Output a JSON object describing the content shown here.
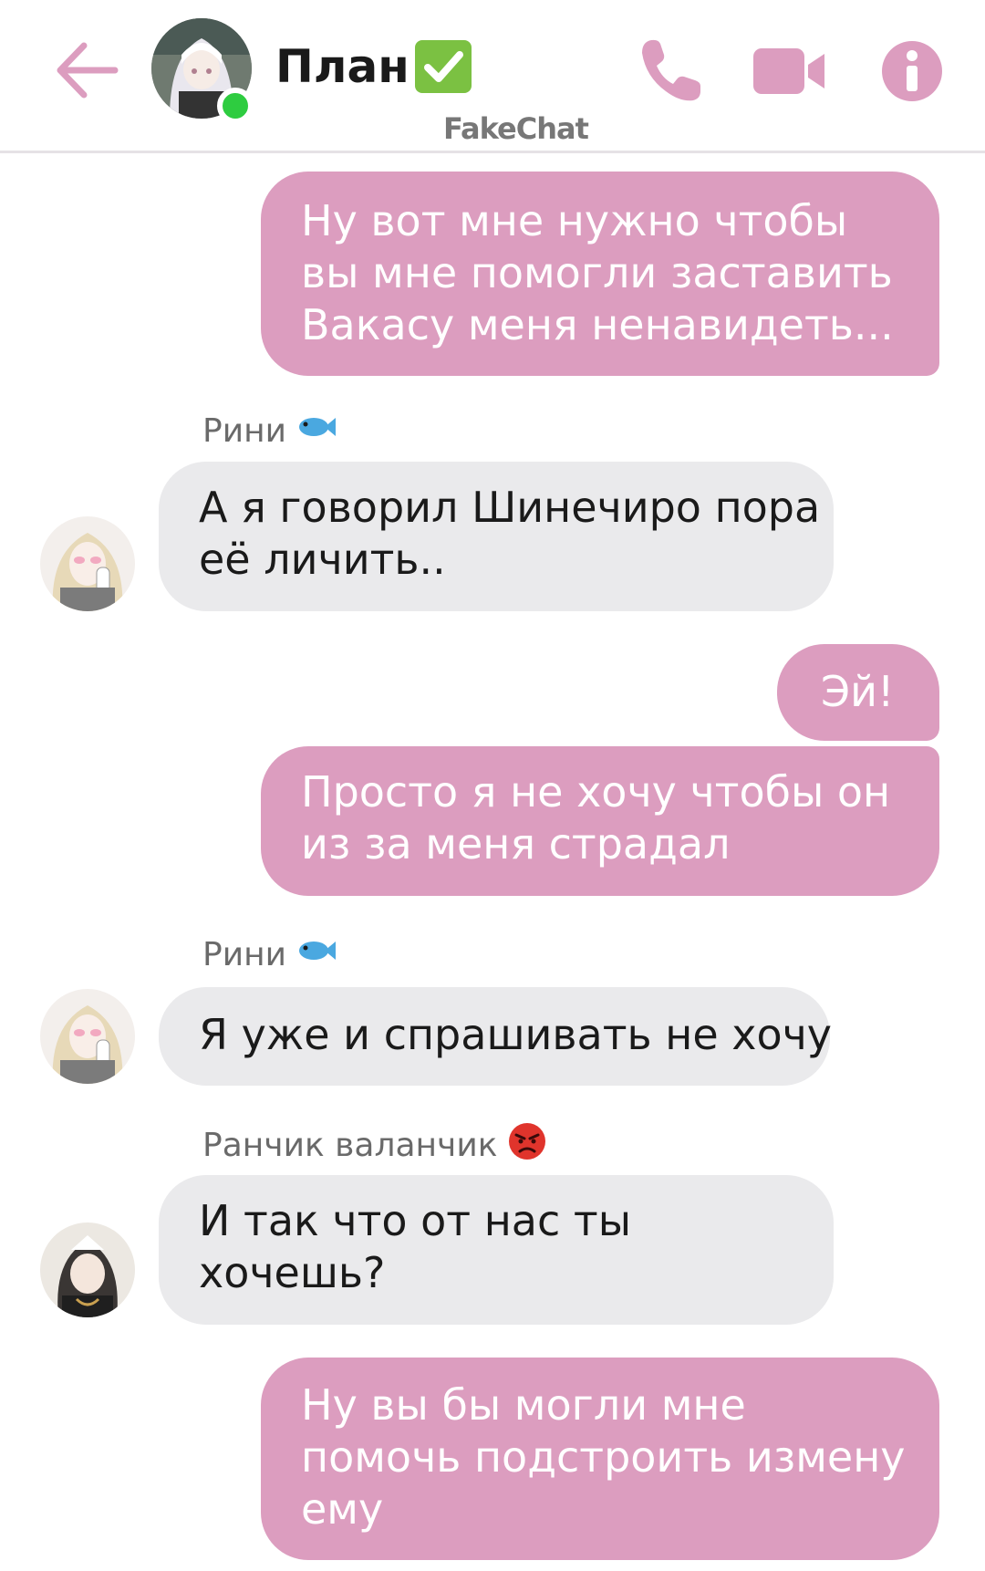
{
  "header": {
    "title": "План",
    "watermark": "FakeChat",
    "online": true,
    "icons": [
      "back-arrow-icon",
      "phone-icon",
      "video-camera-icon",
      "info-icon",
      "verified-check-icon"
    ]
  },
  "colors": {
    "accent": "#dc9dbf",
    "outgoing_bubble": "#dc9dbf",
    "incoming_bubble": "#eaeaec",
    "online": "#2ecc40"
  },
  "messages": [
    {
      "direction": "out",
      "text_lines": [
        "Ну вот мне нужно чтобы",
        "вы мне помогли заставить",
        "Вакасу меня ненавидеть..."
      ]
    },
    {
      "direction": "in",
      "sender": "Рини",
      "sender_emoji": "fish",
      "text_lines": [
        "А я говорил Шинечиро пора",
        "её личить.."
      ]
    },
    {
      "direction": "out",
      "text_lines": [
        "Эй!"
      ]
    },
    {
      "direction": "out",
      "text_lines": [
        "Просто я не хочу чтобы он",
        "из за меня страдал"
      ]
    },
    {
      "direction": "in",
      "sender": "Рини",
      "sender_emoji": "fish",
      "text_lines": [
        "Я уже и спрашивать не хочу"
      ]
    },
    {
      "direction": "in",
      "sender": "Ранчик валанчик",
      "sender_emoji": "angry-face",
      "text_lines": [
        "И так что от нас ты",
        "хочешь?"
      ]
    },
    {
      "direction": "out",
      "text_lines": [
        "Ну вы бы могли мне",
        "помочь подстроить измену",
        "ему"
      ]
    }
  ]
}
